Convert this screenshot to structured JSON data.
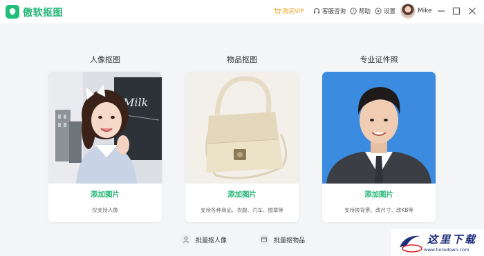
{
  "app": {
    "name": "傲软抠图"
  },
  "titlebar": {
    "buy_vip": "购买VIP",
    "support": "客服咨询",
    "help": "帮助",
    "settings": "设置",
    "user_name": "Mike"
  },
  "cards": [
    {
      "title": "人像抠图",
      "action": "添加图片",
      "desc": "仅支持人像"
    },
    {
      "title": "物品抠图",
      "action": "添加图片",
      "desc": "支持各种商品、衣服、汽车、图章等"
    },
    {
      "title": "专业证件照",
      "action": "添加图片",
      "desc": "支持换背景、改尺寸、改KB等"
    }
  ],
  "batch": {
    "portrait": "批量抠人像",
    "object": "批量抠物品"
  },
  "watermark": {
    "text": "这里下载",
    "url": "www.heredown.com"
  },
  "colors": {
    "accent": "#1fb573",
    "vip": "#f2a019",
    "idphoto_bg": "#3b8be0"
  }
}
